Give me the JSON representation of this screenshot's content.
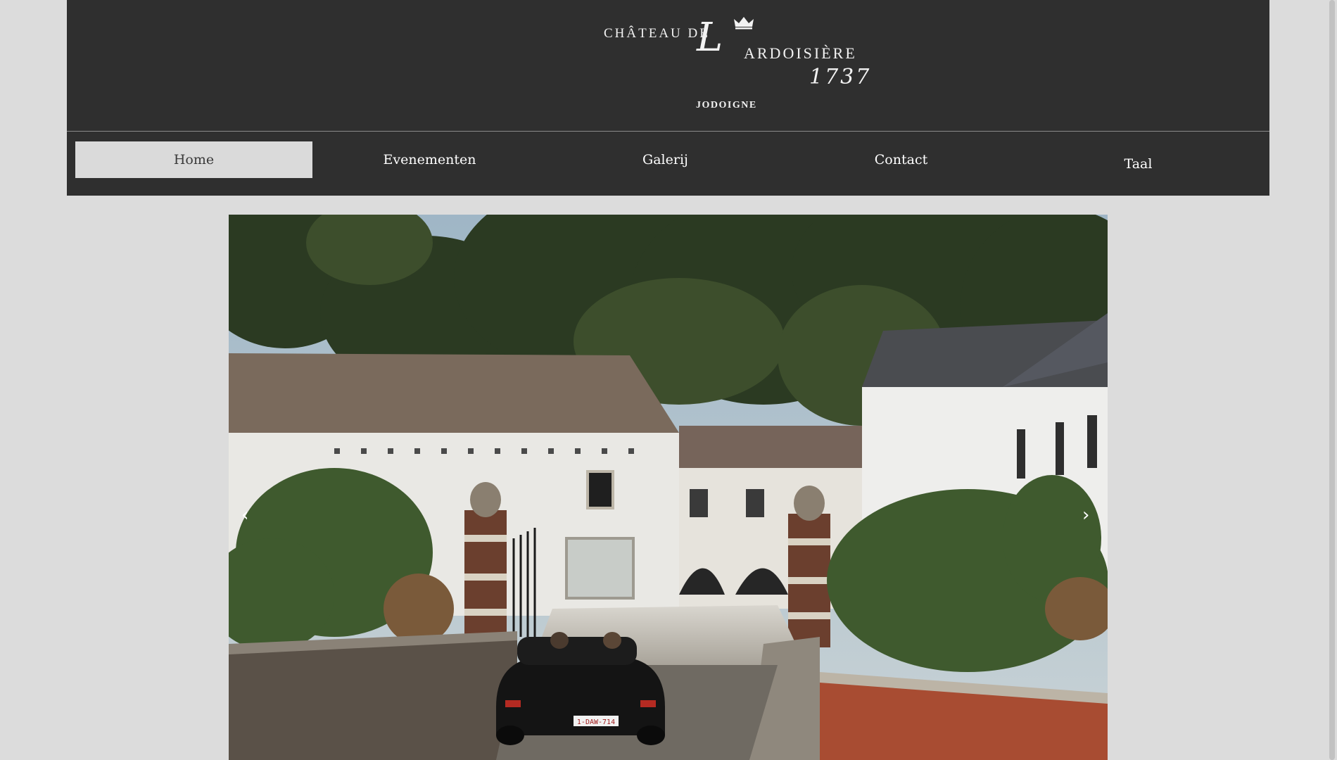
{
  "header": {
    "logo": {
      "line1": "CHÂTEAU DE",
      "initial": "L",
      "line2": "ARDOISIÈRE",
      "year": "1737",
      "town": "JODOIGNE"
    }
  },
  "nav": {
    "items": [
      {
        "label": "Home",
        "active": true
      },
      {
        "label": "Evenementen",
        "active": false
      },
      {
        "label": "Galerij",
        "active": false
      },
      {
        "label": "Contact",
        "active": false
      },
      {
        "label": "Taal",
        "active": false
      }
    ]
  },
  "slider": {
    "prev_glyph": "‹",
    "next_glyph": "›",
    "car_plate": "1-DAW-714"
  },
  "colors": {
    "page_bg": "#dcdcdc",
    "header_bg": "#2f2f2f",
    "nav_active_bg": "#dadada"
  }
}
